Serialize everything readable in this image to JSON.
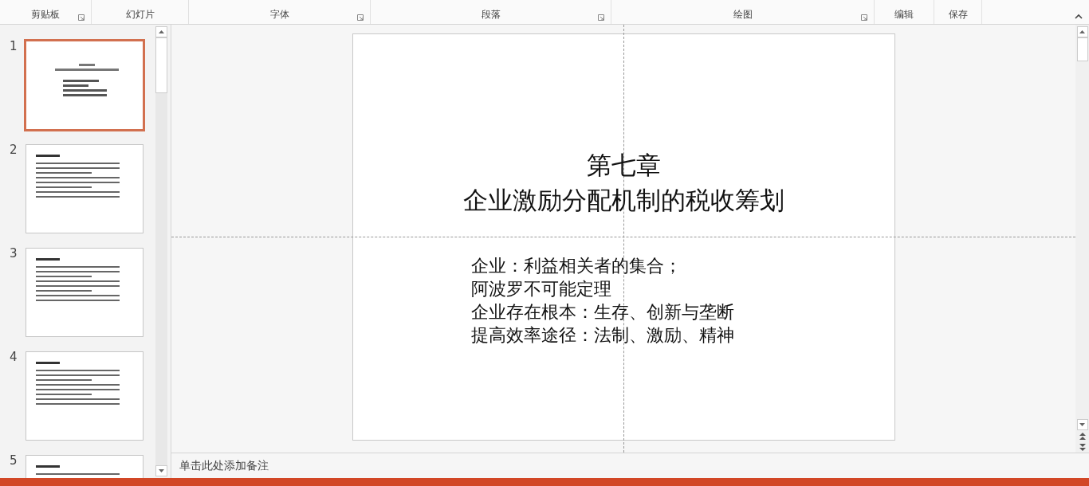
{
  "ribbon": {
    "groups": [
      {
        "label": "剪贴板",
        "launcher": true
      },
      {
        "label": "幻灯片",
        "launcher": false
      },
      {
        "label": "字体",
        "launcher": true
      },
      {
        "label": "段落",
        "launcher": true
      },
      {
        "label": "绘图",
        "launcher": true
      },
      {
        "label": "编辑",
        "launcher": false
      },
      {
        "label": "保存",
        "launcher": false
      }
    ]
  },
  "thumbnails": [
    {
      "number": "1",
      "selected": true,
      "kind": "title"
    },
    {
      "number": "2",
      "selected": false,
      "kind": "bullets"
    },
    {
      "number": "3",
      "selected": false,
      "kind": "bullets"
    },
    {
      "number": "4",
      "selected": false,
      "kind": "bullets"
    },
    {
      "number": "5",
      "selected": false,
      "kind": "bullets"
    }
  ],
  "slide": {
    "title": [
      "第七章",
      "企业激励分配机制的税收筹划"
    ],
    "body": [
      "企业：利益相关者的集合；",
      "阿波罗不可能定理",
      "企业存在根本：生存、创新与垄断",
      "提高效率途径：法制、激励、精神"
    ]
  },
  "notes": {
    "placeholder": "单击此处添加备注"
  }
}
